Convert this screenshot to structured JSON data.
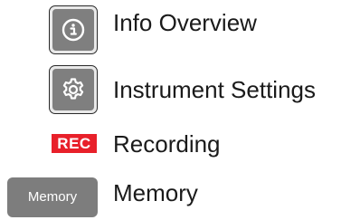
{
  "legend": {
    "items": [
      {
        "icon": "info-icon",
        "label": "Info Overview"
      },
      {
        "icon": "gear-icon",
        "label": "Instrument Settings"
      },
      {
        "icon": "rec-badge",
        "badge_text": "REC",
        "label": "Recording"
      },
      {
        "icon": "memory-button",
        "button_text": "Memory",
        "label": "Memory"
      }
    ]
  },
  "colors": {
    "button_gray": "#7f7f7f",
    "rec_red": "#e8202a",
    "text": "#1a1a1a"
  }
}
